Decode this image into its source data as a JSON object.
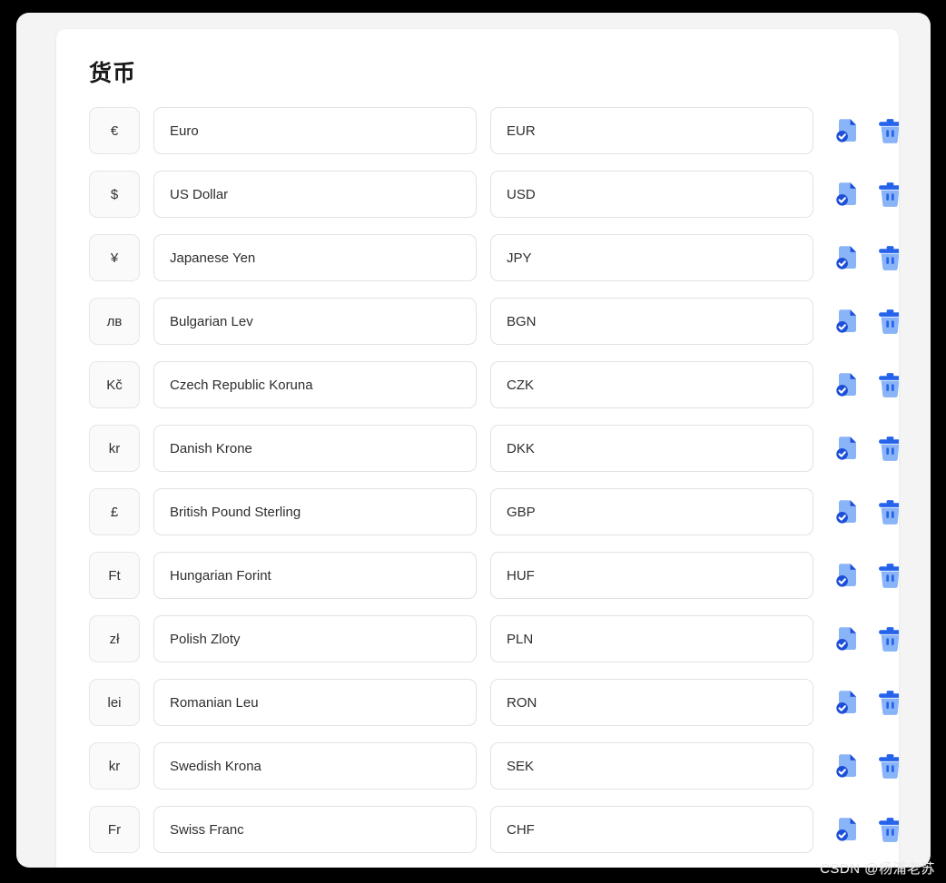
{
  "card": {
    "title": "货币"
  },
  "colors": {
    "page_background": "#f4f4f5",
    "card_background": "#ffffff",
    "frame": "#000000",
    "symbol_box_background": "#fafafa",
    "field_border": "#e2e2e5",
    "text": "#2e2e32",
    "icon_blue_light": "#8ab4f8",
    "icon_blue_dark": "#1d4ed8",
    "icon_blue_mid": "#2563eb",
    "watermark": "#e9e9ea"
  },
  "actions": {
    "save_icon": "document-check-icon",
    "save_label": "保存",
    "delete_icon": "trash-icon",
    "delete_label": "删除"
  },
  "rows": [
    {
      "symbol": "€",
      "name": "Euro",
      "code": "EUR"
    },
    {
      "symbol": "$",
      "name": "US Dollar",
      "code": "USD"
    },
    {
      "symbol": "¥",
      "name": "Japanese Yen",
      "code": "JPY"
    },
    {
      "symbol": "лв",
      "name": "Bulgarian Lev",
      "code": "BGN"
    },
    {
      "symbol": "Kč",
      "name": "Czech Republic Koruna",
      "code": "CZK"
    },
    {
      "symbol": "kr",
      "name": "Danish Krone",
      "code": "DKK"
    },
    {
      "symbol": "£",
      "name": "British Pound Sterling",
      "code": "GBP"
    },
    {
      "symbol": "Ft",
      "name": "Hungarian Forint",
      "code": "HUF"
    },
    {
      "symbol": "zł",
      "name": "Polish Zloty",
      "code": "PLN"
    },
    {
      "symbol": "lei",
      "name": "Romanian Leu",
      "code": "RON"
    },
    {
      "symbol": "kr",
      "name": "Swedish Krona",
      "code": "SEK"
    },
    {
      "symbol": "Fr",
      "name": "Swiss Franc",
      "code": "CHF"
    }
  ],
  "watermark": {
    "text": "CSDN @杨浦老苏"
  }
}
